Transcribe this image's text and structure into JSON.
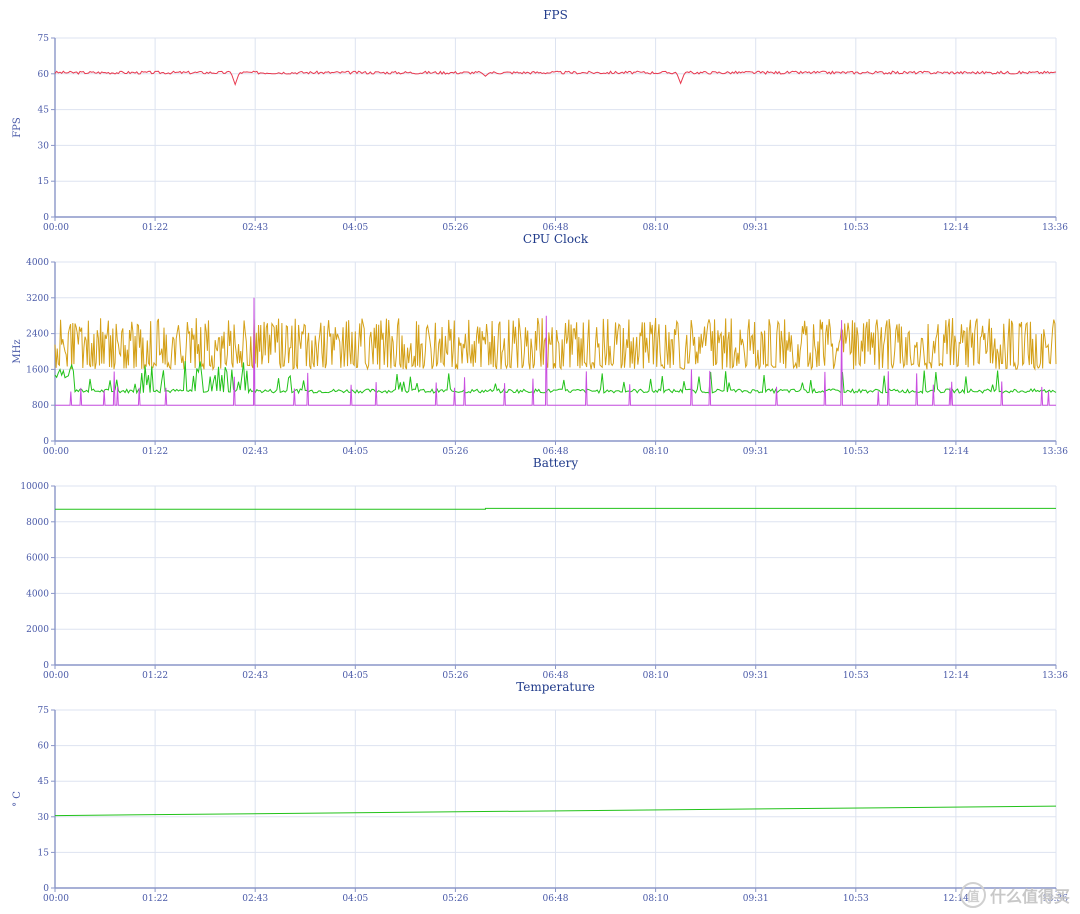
{
  "x_ticks": [
    "00:00",
    "01:22",
    "02:43",
    "04:05",
    "05:26",
    "06:48",
    "08:10",
    "09:31",
    "10:53",
    "12:14",
    "13:36"
  ],
  "watermark": {
    "icon": "值",
    "text": "什么值得买"
  },
  "colors": {
    "fps": "#e8394f",
    "cpu_gold": "#d4a017",
    "cpu_green": "#22c21a",
    "cpu_purple": "#c94fe0",
    "battery": "#22c21a",
    "temp": "#22c21a"
  },
  "chart_data": [
    {
      "id": "fps",
      "type": "line",
      "title": "FPS",
      "ylabel": "FPS",
      "xlabel": "",
      "ylim": [
        0,
        75
      ],
      "yticks": [
        0,
        15,
        30,
        45,
        60,
        75
      ],
      "grid": true,
      "series": [
        {
          "color": "#e8394f",
          "kind": "noise",
          "base": 60.5,
          "amp": 0.6,
          "seed": 3,
          "dips": [
            [
              0.18,
              55.5
            ],
            [
              0.43,
              59.0
            ],
            [
              0.625,
              56.0
            ]
          ]
        }
      ]
    },
    {
      "id": "cpu",
      "type": "line",
      "title": "CPU Clock",
      "ylabel": "MHz",
      "xlabel": "",
      "ylim": [
        0,
        4000
      ],
      "yticks": [
        0,
        800,
        1600,
        2400,
        3200,
        4000
      ],
      "grid": true,
      "series": [
        {
          "color": "#d4a017",
          "kind": "osc",
          "low": 1600,
          "high": 2750,
          "seed": 11
        },
        {
          "color": "#22c21a",
          "kind": "spiky",
          "base": 1100,
          "peak": 1800,
          "seed": 7
        },
        {
          "color": "#c94fe0",
          "kind": "impulse",
          "base": 800,
          "peak": 1600,
          "seed": 5,
          "tall": [
            [
              0.198,
              3200
            ],
            [
              0.49,
              2800
            ],
            [
              0.785,
              2700
            ]
          ]
        }
      ]
    },
    {
      "id": "battery",
      "type": "line",
      "title": "Battery",
      "ylabel": "",
      "xlabel": "",
      "ylim": [
        0,
        10000
      ],
      "yticks": [
        0,
        2000,
        4000,
        6000,
        8000,
        10000
      ],
      "grid": true,
      "series": [
        {
          "color": "#22c21a",
          "kind": "step",
          "points": [
            [
              0,
              8700
            ],
            [
              0.43,
              8700
            ],
            [
              0.43,
              8750
            ],
            [
              1,
              8750
            ]
          ]
        }
      ]
    },
    {
      "id": "temperature",
      "type": "line",
      "title": "Temperature",
      "ylabel": "° C",
      "xlabel": "",
      "ylim": [
        0,
        75
      ],
      "yticks": [
        0,
        15,
        30,
        45,
        60,
        75
      ],
      "grid": true,
      "series": [
        {
          "color": "#22c21a",
          "kind": "linear",
          "from": 30.5,
          "to": 34.5
        }
      ]
    }
  ]
}
